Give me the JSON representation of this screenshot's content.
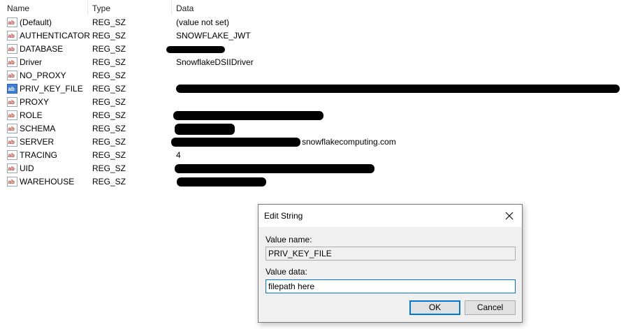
{
  "columns": {
    "name": "Name",
    "type": "Type",
    "data": "Data"
  },
  "values": [
    {
      "name": "(Default)",
      "type": "REG_SZ",
      "data": "(value not set)",
      "icon": "registry-string-icon"
    },
    {
      "name": "AUTHENTICATOR",
      "type": "REG_SZ",
      "data": "SNOWFLAKE_JWT",
      "icon": "registry-string-icon"
    },
    {
      "name": "DATABASE",
      "type": "REG_SZ",
      "data": "",
      "icon": "registry-string-icon"
    },
    {
      "name": "Driver",
      "type": "REG_SZ",
      "data": "SnowflakeDSIIDriver",
      "icon": "registry-string-icon"
    },
    {
      "name": "NO_PROXY",
      "type": "REG_SZ",
      "data": "",
      "icon": "registry-string-icon"
    },
    {
      "name": "PRIV_KEY_FILE",
      "type": "REG_SZ",
      "data": "",
      "icon": "registry-string-icon"
    },
    {
      "name": "PROXY",
      "type": "REG_SZ",
      "data": "",
      "icon": "registry-string-icon"
    },
    {
      "name": "ROLE",
      "type": "REG_SZ",
      "data": "",
      "icon": "registry-string-icon"
    },
    {
      "name": "SCHEMA",
      "type": "REG_SZ",
      "data": "",
      "icon": "registry-string-icon"
    },
    {
      "name": "SERVER",
      "type": "REG_SZ",
      "data": "snowflakecomputing.com",
      "icon": "registry-string-icon"
    },
    {
      "name": "TRACING",
      "type": "REG_SZ",
      "data": "4",
      "icon": "registry-string-icon"
    },
    {
      "name": "UID",
      "type": "REG_SZ",
      "data": "",
      "icon": "registry-string-icon"
    },
    {
      "name": "WAREHOUSE",
      "type": "REG_SZ",
      "data": "",
      "icon": "registry-string-icon"
    }
  ],
  "dialog": {
    "title": "Edit String",
    "value_name_label": "Value name:",
    "value_name": "PRIV_KEY_FILE",
    "value_data_label": "Value data:",
    "value_data": "filepath here",
    "ok_label": "OK",
    "cancel_label": "Cancel",
    "close_icon": "close-icon"
  },
  "colors": {
    "accent": "#0078d7",
    "icon_red": "#c0392b",
    "icon_blue_bg": "#3d7fd6"
  }
}
